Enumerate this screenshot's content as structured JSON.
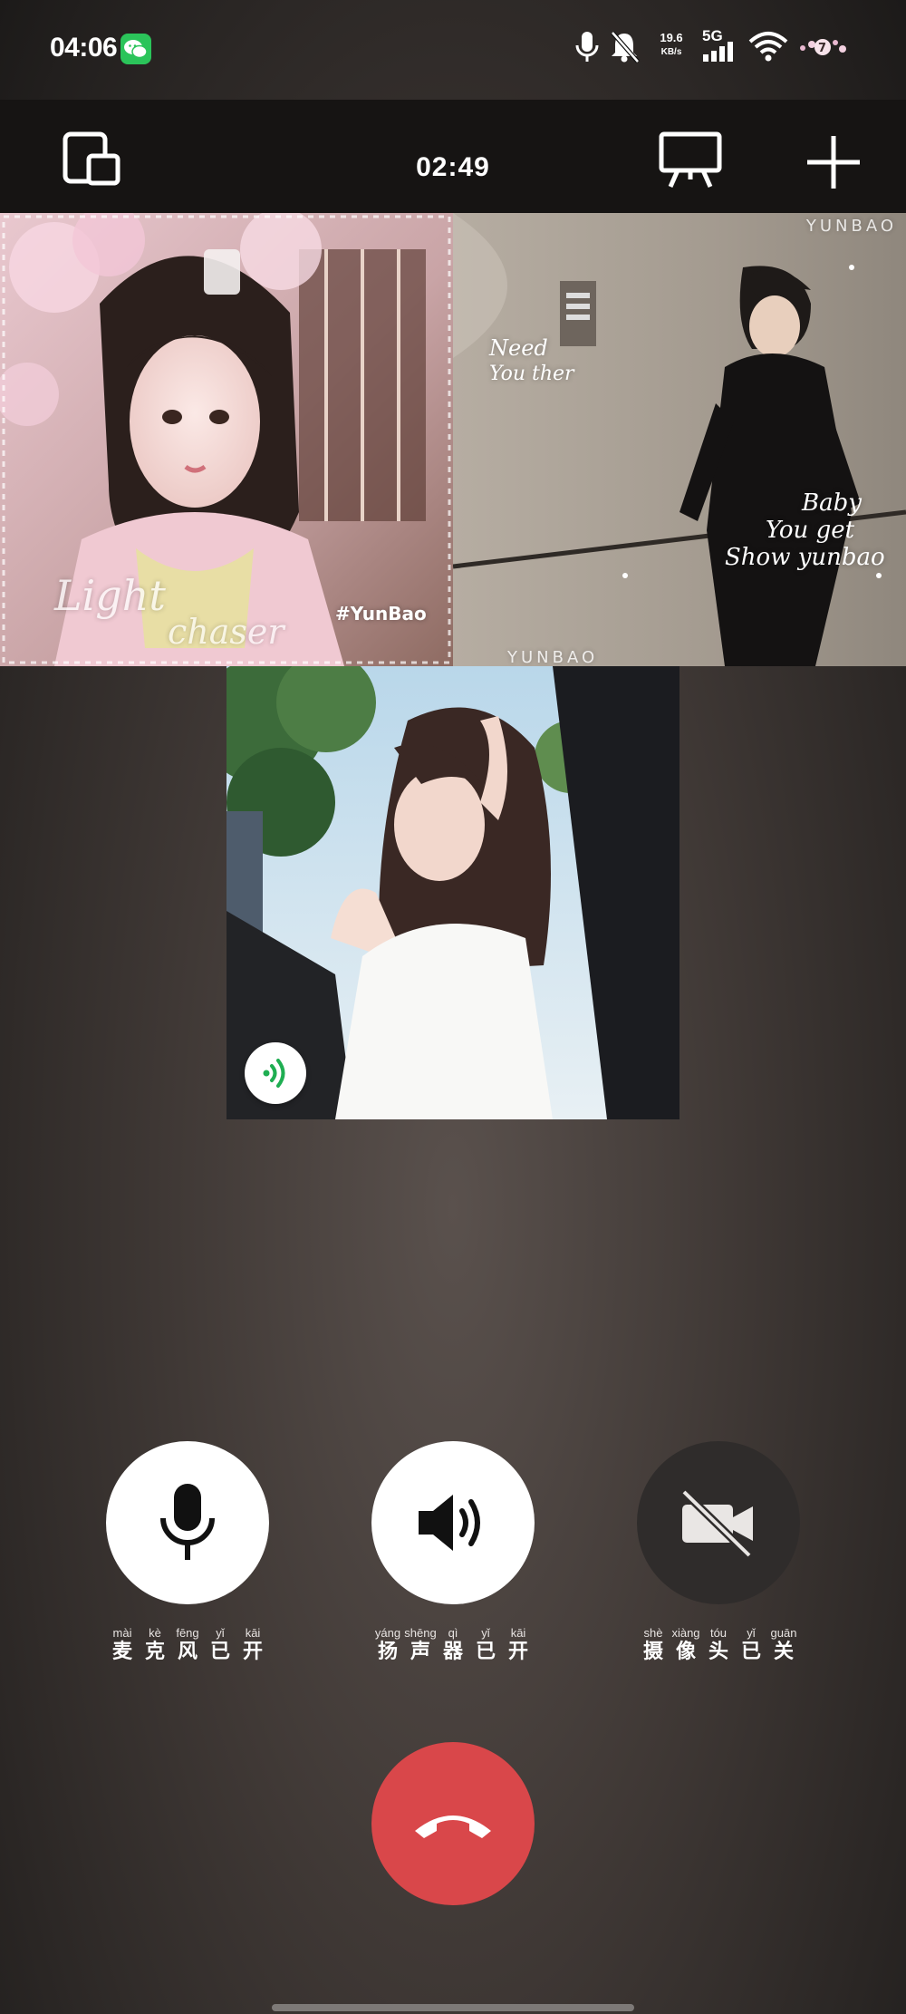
{
  "status_bar": {
    "time": "04:06",
    "net_speed": "19.6",
    "net_speed_unit": "KB/s",
    "network": "5G",
    "icons": [
      "wechat-icon",
      "mic-icon",
      "bell-muted-icon",
      "signal-icon",
      "wifi-icon",
      "battery-icon"
    ]
  },
  "call": {
    "timer": "02:49"
  },
  "tiles": {
    "tile1": {
      "overlay_light": "Light",
      "overlay_chaser": "chaser",
      "tag": "#YunBao"
    },
    "tile2": {
      "need": "Need",
      "you_ther": "You ther",
      "baby": "Baby",
      "you_get": "You get",
      "show": "Show yunbao",
      "brand": "YUNBAO",
      "brand_bottom": "YUNBAO"
    }
  },
  "controls": {
    "mic": {
      "state": "on",
      "chars": [
        {
          "py": "mài",
          "hz": "麦"
        },
        {
          "py": "kè",
          "hz": "克"
        },
        {
          "py": "fēng",
          "hz": "风"
        },
        {
          "py": "yǐ",
          "hz": "已"
        },
        {
          "py": "kāi",
          "hz": "开"
        }
      ]
    },
    "speaker": {
      "state": "on",
      "chars": [
        {
          "py": "yáng",
          "hz": "扬"
        },
        {
          "py": "shēng",
          "hz": "声"
        },
        {
          "py": "qì",
          "hz": "器"
        },
        {
          "py": "yǐ",
          "hz": "已"
        },
        {
          "py": "kāi",
          "hz": "开"
        }
      ]
    },
    "camera": {
      "state": "off",
      "chars": [
        {
          "py": "shè",
          "hz": "摄"
        },
        {
          "py": "xiàng",
          "hz": "像"
        },
        {
          "py": "tóu",
          "hz": "头"
        },
        {
          "py": "yǐ",
          "hz": "已"
        },
        {
          "py": "guān",
          "hz": "关"
        }
      ]
    }
  },
  "colors": {
    "hangup": "#d9474a",
    "speaking": "#1fae52",
    "wechat": "#2bc45a"
  }
}
